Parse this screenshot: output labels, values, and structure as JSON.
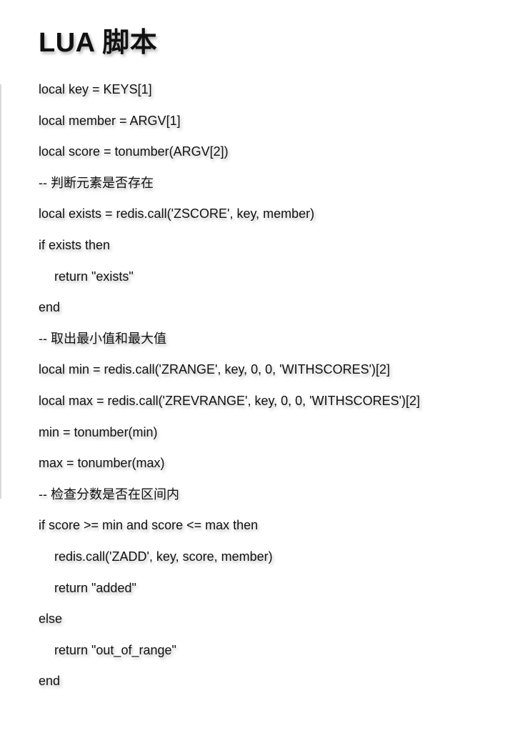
{
  "title": "LUA 脚本",
  "code_lines": [
    "local key = KEYS[1]",
    "local member = ARGV[1]",
    "local score = tonumber(ARGV[2])",
    "-- 判断元素是否存在",
    "local exists = redis.call('ZSCORE', key, member)",
    "if exists then",
    "return \"exists\"",
    "end",
    "-- 取出最小值和最大值",
    "local min = redis.call('ZRANGE', key, 0, 0, 'WITHSCORES')[2]",
    "local max = redis.call('ZREVRANGE', key, 0, 0, 'WITHSCORES')[2]",
    "min = tonumber(min)",
    "max = tonumber(max)",
    "-- 检查分数是否在区间内",
    "if score >= min and score <= max then",
    "redis.call('ZADD', key, score, member)",
    "return \"added\"",
    "else",
    "return \"out_of_range\"",
    "end"
  ]
}
